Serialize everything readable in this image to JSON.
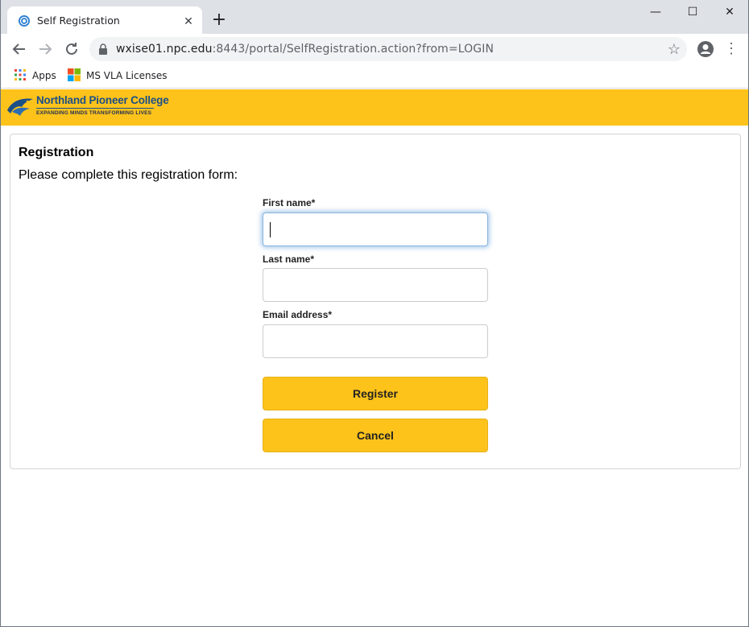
{
  "browser": {
    "tab_title": "Self Registration",
    "tab_close": "✕",
    "new_tab": "+",
    "window_controls": {
      "minimize": "—",
      "maximize": "☐",
      "close": "✕"
    },
    "url_host": "wxise01.npc.edu",
    "url_rest": ":8443/portal/SelfRegistration.action?from=LOGIN",
    "bookmarks": [
      {
        "label": "Apps",
        "icon": "apps-grid-icon"
      },
      {
        "label": "MS VLA Licenses",
        "icon": "windows-logo-icon"
      }
    ]
  },
  "brand": {
    "name": "Northland Pioneer College",
    "tagline": "EXPANDING MINDS   TRANSFORMING LIVES",
    "banner_color": "#fdc31b",
    "logo_color": "#1c4f87"
  },
  "form": {
    "title": "Registration",
    "subtitle": "Please complete this registration form:",
    "fields": [
      {
        "label": "First name*",
        "value": ""
      },
      {
        "label": "Last name*",
        "value": ""
      },
      {
        "label": "Email address*",
        "value": ""
      }
    ],
    "register_label": "Register",
    "cancel_label": "Cancel"
  }
}
